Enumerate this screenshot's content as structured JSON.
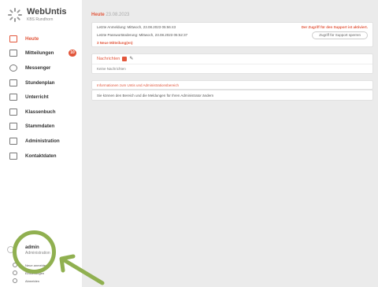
{
  "app": {
    "name": "WebUntis",
    "school": "KBS Rundhorn"
  },
  "sidebar": {
    "items": [
      {
        "label": "Heute",
        "icon": "home-icon",
        "active": true
      },
      {
        "label": "Mitteilungen",
        "icon": "mail-icon",
        "badge": "10"
      },
      {
        "label": "Messenger",
        "icon": "chat-icon"
      },
      {
        "label": "Stundenplan",
        "icon": "calendar-icon"
      },
      {
        "label": "Unterricht",
        "icon": "book-icon"
      },
      {
        "label": "Klassenbuch",
        "icon": "classbook-icon"
      },
      {
        "label": "Stammdaten",
        "icon": "database-icon"
      },
      {
        "label": "Administration",
        "icon": "admin-icon"
      },
      {
        "label": "Kontaktdaten",
        "icon": "contact-icon"
      }
    ],
    "user": {
      "name": "admin",
      "role": "Administration"
    },
    "footer": [
      {
        "label": "Neue anmelden",
        "icon": "check-icon"
      },
      {
        "label": "Einstellungen",
        "icon": "gear-icon"
      },
      {
        "label": "Abmelden",
        "icon": "logout-icon"
      }
    ]
  },
  "main": {
    "title": "Heute",
    "date": "23.08.2023",
    "info_card": {
      "line1": "Letzte Anmeldung: Mittwoch, 23.08.2023 05:56:43",
      "line2": "Letzte Passwortänderung: Mittwoch, 23.08.2023 05:52:37",
      "link": "3 Neue Mitteilung(en)",
      "support_note": "Der Zugriff für den Support ist aktiviert.",
      "support_button": "Zugriff für Support sperren"
    },
    "news_card": {
      "title": "Nachrichten",
      "text": "Keine Nachrichten"
    },
    "notice_card": {
      "text": "Informationen zum Untis und Administrationsbereich"
    },
    "hint_card": {
      "text": "Sie können den Bereich und die Meldungen für Ihren Administrator ändern"
    },
    "colors": {
      "accent": "#e2563b",
      "background": "#ebebeb",
      "highlight": "#90b050"
    }
  }
}
